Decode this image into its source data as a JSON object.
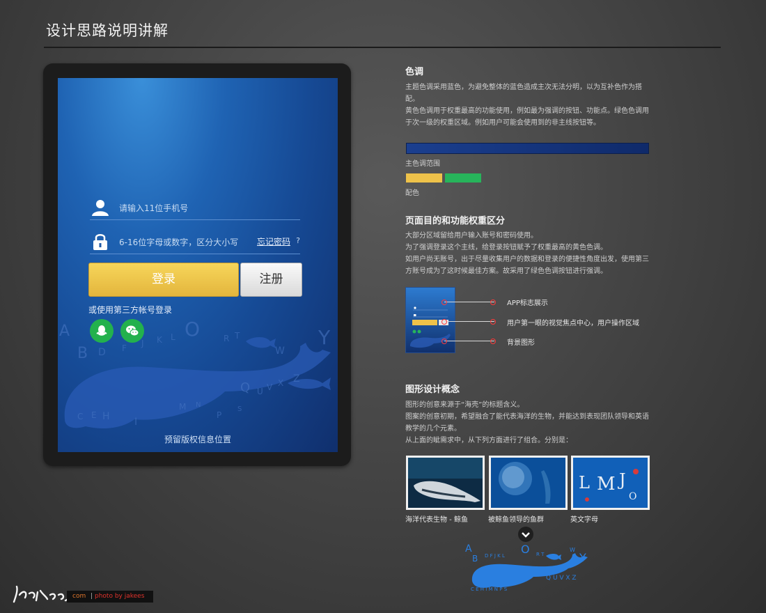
{
  "page": {
    "title": "设计思路说明讲解"
  },
  "device": {
    "phone_placeholder": "请输入11位手机号",
    "password_placeholder": "6-16位字母或数字，区分大小写",
    "forgot_link": "忘记密码",
    "forgot_q": "?",
    "login_label": "登录",
    "register_label": "注册",
    "third_party_text": "或使用第三方帐号登录",
    "copyright": "预留版权信息位置",
    "bg_letters": [
      "A",
      "B",
      "D",
      "F",
      "J",
      "K",
      "L",
      "O",
      "R",
      "T",
      "W",
      "Y",
      "Q",
      "U",
      "V",
      "X",
      "Z",
      "C",
      "E",
      "H",
      "I",
      "M",
      "N",
      "P",
      "S"
    ]
  },
  "sections": {
    "color": {
      "heading": "色调",
      "paragraphs": [
        "主题色调采用蓝色，为避免整体的蓝色造成主次无法分明，以为互补色作为搭配。",
        "黄色色调用于权重最高的功能使用，例如最为强调的按钮、功能点。绿色色调用于次一级的权重区域。例如用户可能会使用到的非主线按钮等。"
      ],
      "main_range_caption": "主色调范围",
      "accent_caption": "配色",
      "colors": {
        "main_start": "#1b3f8f",
        "main_end": "#0f2a6a",
        "yellow": "#eec24a",
        "green": "#27b45b"
      }
    },
    "purpose": {
      "heading": "页面目的和功能权重区分",
      "paragraphs": [
        "大部分区域留给用户输入账号和密码使用。",
        "为了强调登录这个主线，给登录按钮赋予了权重最高的黄色色调。",
        "如用户尚无账号，出于尽量收集用户的数据和登录的便捷性角度出发，使用第三方账号成为了这时候最佳方案。故采用了绿色色调按钮进行强调。"
      ],
      "callouts": [
        "APP标志展示",
        "用户第一眼的视觉焦点中心，用户操作区域",
        "背景图形"
      ]
    },
    "concept": {
      "heading": "图形设计概念",
      "paragraphs": [
        "图形的创意来源于“海壳”的标题含义。",
        "图案的创意初期，希望融合了能代表海洋的生物，并能达到表现团队领导和英语教学的几个元素。",
        "从上面的眦需求中，从下列方面进行了组合。分别是："
      ],
      "photos": [
        "海洋代表生物 - 鲸鱼",
        "被鲸鱼领导的鱼群",
        "英文字母"
      ]
    }
  },
  "watermark": {
    "com": "com",
    "sep": "|",
    "by": "photo by jakees"
  }
}
